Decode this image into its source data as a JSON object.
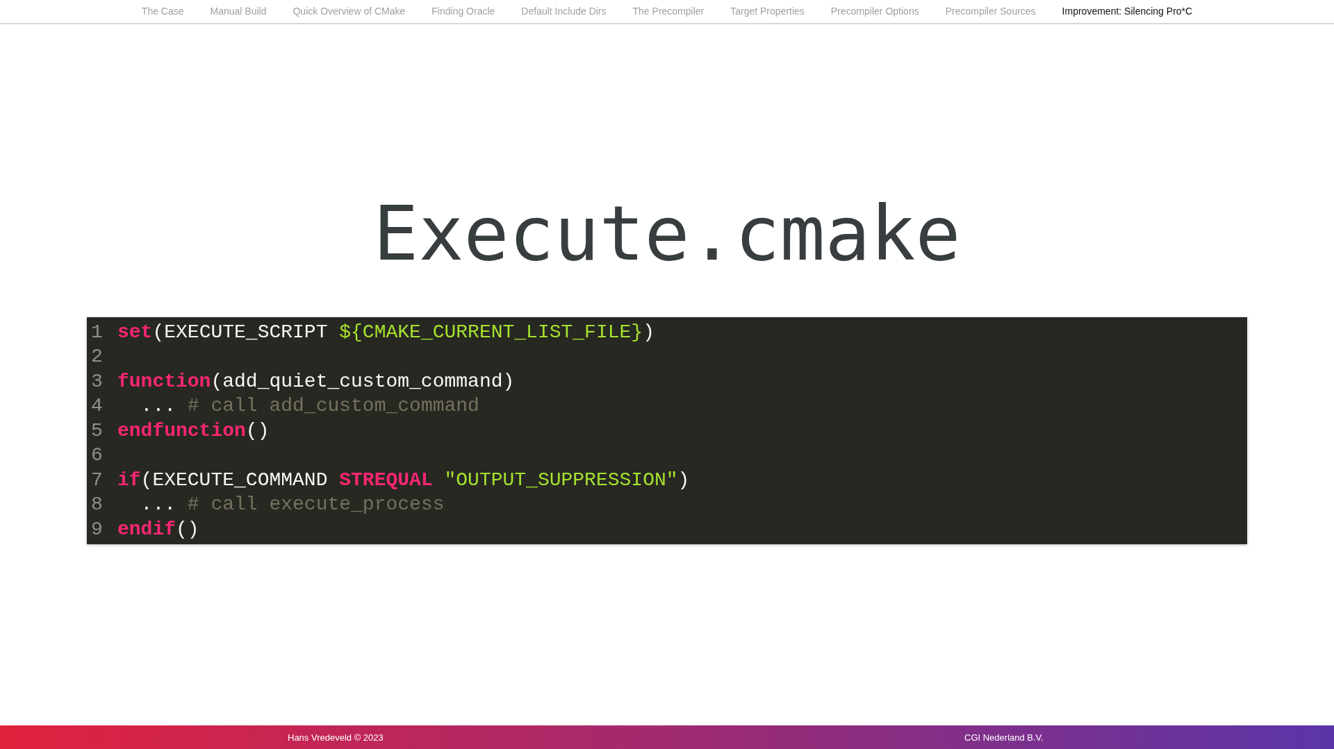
{
  "nav": [
    {
      "label": "The Case",
      "selected": false
    },
    {
      "label": "Manual Build",
      "selected": false
    },
    {
      "label": "Quick Overview of CMake",
      "selected": false
    },
    {
      "label": "Finding Oracle",
      "selected": false
    },
    {
      "label": "Default Include Dirs",
      "selected": false
    },
    {
      "label": "The Precompiler",
      "selected": false
    },
    {
      "label": "Target Properties",
      "selected": false
    },
    {
      "label": "Precompiler Options",
      "selected": false
    },
    {
      "label": "Precompiler Sources",
      "selected": false
    },
    {
      "label": "Improvement: Silencing Pro*C",
      "selected": true
    }
  ],
  "slide": {
    "title": "Execute.cmake",
    "code": [
      {
        "number": "1",
        "tokens": [
          {
            "kind": "keyword",
            "text": "set"
          },
          {
            "kind": "plain",
            "text": "(EXECUTE_SCRIPT "
          },
          {
            "kind": "string",
            "text": "${CMAKE_CURRENT_LIST_FILE}"
          },
          {
            "kind": "plain",
            "text": ")"
          }
        ]
      },
      {
        "number": "2"
      },
      {
        "number": "3",
        "tokens": [
          {
            "kind": "keyword",
            "text": "function"
          },
          {
            "kind": "plain",
            "text": "(add_quiet_custom_command)"
          }
        ]
      },
      {
        "number": "4",
        "tokens": [
          {
            "kind": "plain",
            "text": "  ... "
          },
          {
            "kind": "comment",
            "text": "# call add_custom_command"
          }
        ]
      },
      {
        "number": "5",
        "tokens": [
          {
            "kind": "keyword",
            "text": "endfunction"
          },
          {
            "kind": "plain",
            "text": "()"
          }
        ]
      },
      {
        "number": "6"
      },
      {
        "number": "7",
        "tokens": [
          {
            "kind": "keyword",
            "text": "if"
          },
          {
            "kind": "plain",
            "text": "(EXECUTE_COMMAND "
          },
          {
            "kind": "keyword",
            "text": "STREQUAL"
          },
          {
            "kind": "string",
            "text": " \"OUTPUT_SUPPRESSION\""
          },
          {
            "kind": "plain",
            "text": ")"
          }
        ]
      },
      {
        "number": "8",
        "tokens": [
          {
            "kind": "plain",
            "text": "  ... "
          },
          {
            "kind": "comment",
            "text": "# call execute_process"
          }
        ]
      },
      {
        "number": "9",
        "tokens": [
          {
            "kind": "keyword",
            "text": "endif"
          },
          {
            "kind": "plain",
            "text": "()"
          }
        ]
      }
    ]
  },
  "footer": {
    "author": "Hans Vredeveld © 2023",
    "company": "CGI Nederland B.V."
  }
}
